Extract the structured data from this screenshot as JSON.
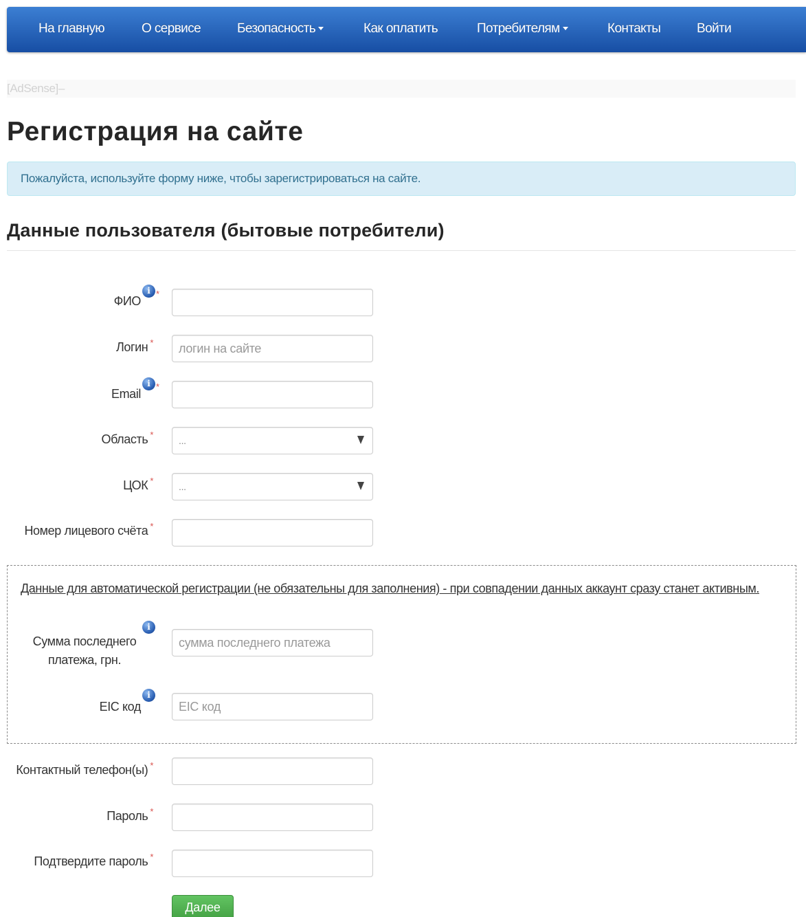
{
  "nav": {
    "home": "На главную",
    "about": "О сервисе",
    "security": "Безопасность",
    "payment": "Как оплатить",
    "consumers": "Потребителям",
    "contacts": "Контакты",
    "login": "Войти"
  },
  "adsense": "[AdSense]–",
  "page": {
    "title": "Регистрация на сайте",
    "info": "Пожалуйста, используйте форму ниже, чтобы зарегистрироваться на сайте."
  },
  "section": {
    "title": "Данные пользователя (бытовые потребители)"
  },
  "form": {
    "fio": {
      "label": "ФИО",
      "value": ""
    },
    "login": {
      "label": "Логин",
      "placeholder": "логин на сайте"
    },
    "email": {
      "label": "Email",
      "value": ""
    },
    "region": {
      "label": "Область",
      "selected": "..."
    },
    "tsok": {
      "label": "ЦОК",
      "selected": "..."
    },
    "account": {
      "label": "Номер лицевого счёта",
      "value": ""
    },
    "auto_note": "Данные для автоматической регистрации (не обязательны для заполнения) - при совпадении данных аккаунт сразу станет активным.",
    "last_payment": {
      "label": "Сумма последнего платежа, грн.",
      "placeholder": "сумма последнего платежа"
    },
    "eic": {
      "label": "EIC код",
      "placeholder": "EIC код"
    },
    "phone": {
      "label": "Контактный телефон(ы)",
      "value": ""
    },
    "password": {
      "label": "Пароль",
      "value": ""
    },
    "confirm": {
      "label": "Подтвердите пароль",
      "value": ""
    },
    "required_mark": "*",
    "info_glyph": "i",
    "submit": "Далее"
  },
  "colors": {
    "navbar_top": "#3c7fd3",
    "navbar_bottom": "#174ea4",
    "alert_bg": "#d9edf7",
    "required": "#d9534f",
    "button": "#5cb85c"
  }
}
